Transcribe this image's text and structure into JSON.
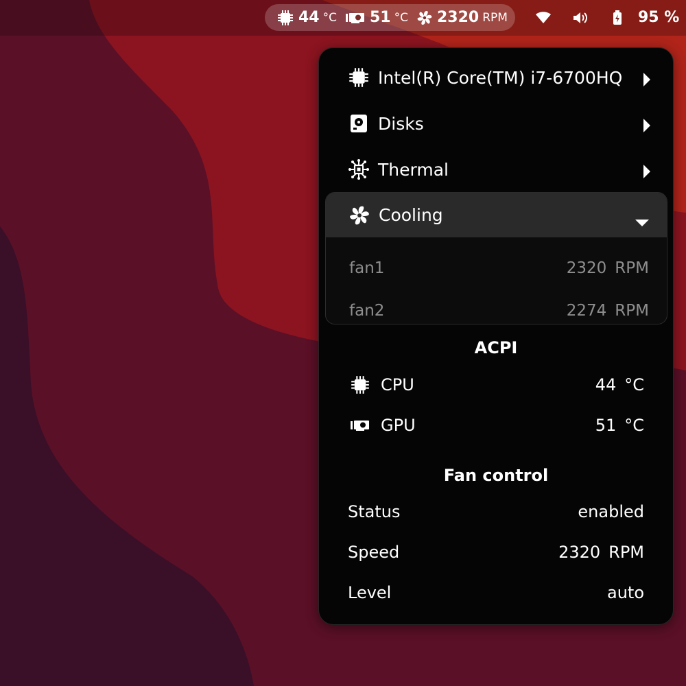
{
  "colors": {
    "wall_base": "#5a1027",
    "wall_dark": "#3a0f28",
    "wall_red": "#8b1420",
    "wall_orange": "#b0241a",
    "menu_bg": "#050505",
    "highlight": "#2a2a2a",
    "dim_text": "#8e8e8e"
  },
  "topbar": {
    "cpu_temp": "44",
    "cpu_unit": "°C",
    "gpu_temp": "51",
    "gpu_unit": "°C",
    "fan_speed": "2320",
    "fan_unit": "RPM",
    "tray_icons": [
      "wifi-icon",
      "volume-icon",
      "battery-icon"
    ],
    "battery": "95 %"
  },
  "menu": {
    "items": [
      {
        "label": "Intel(R) Core(TM) i7-6700HQ",
        "icon": "cpu-chip-icon"
      },
      {
        "label": "Disks",
        "icon": "disk-icon"
      },
      {
        "label": "Thermal",
        "icon": "thermal-circuit-icon"
      }
    ],
    "cooling": {
      "label": "Cooling",
      "icon": "fan-icon",
      "fans": [
        {
          "name": "fan1",
          "value": "2320",
          "unit": "RPM"
        },
        {
          "name": "fan2",
          "value": "2274",
          "unit": "RPM"
        }
      ]
    },
    "acpi": {
      "title": "ACPI",
      "rows": [
        {
          "label": "CPU",
          "icon": "cpu-chip-icon",
          "value": "44",
          "unit": "°C"
        },
        {
          "label": "GPU",
          "icon": "gpu-card-icon",
          "value": "51",
          "unit": "°C"
        }
      ]
    },
    "fan_control": {
      "title": "Fan control",
      "status_label": "Status",
      "status_value": "enabled",
      "speed_label": "Speed",
      "speed_value": "2320",
      "speed_unit": "RPM",
      "level_label": "Level",
      "level_value": "auto"
    }
  }
}
